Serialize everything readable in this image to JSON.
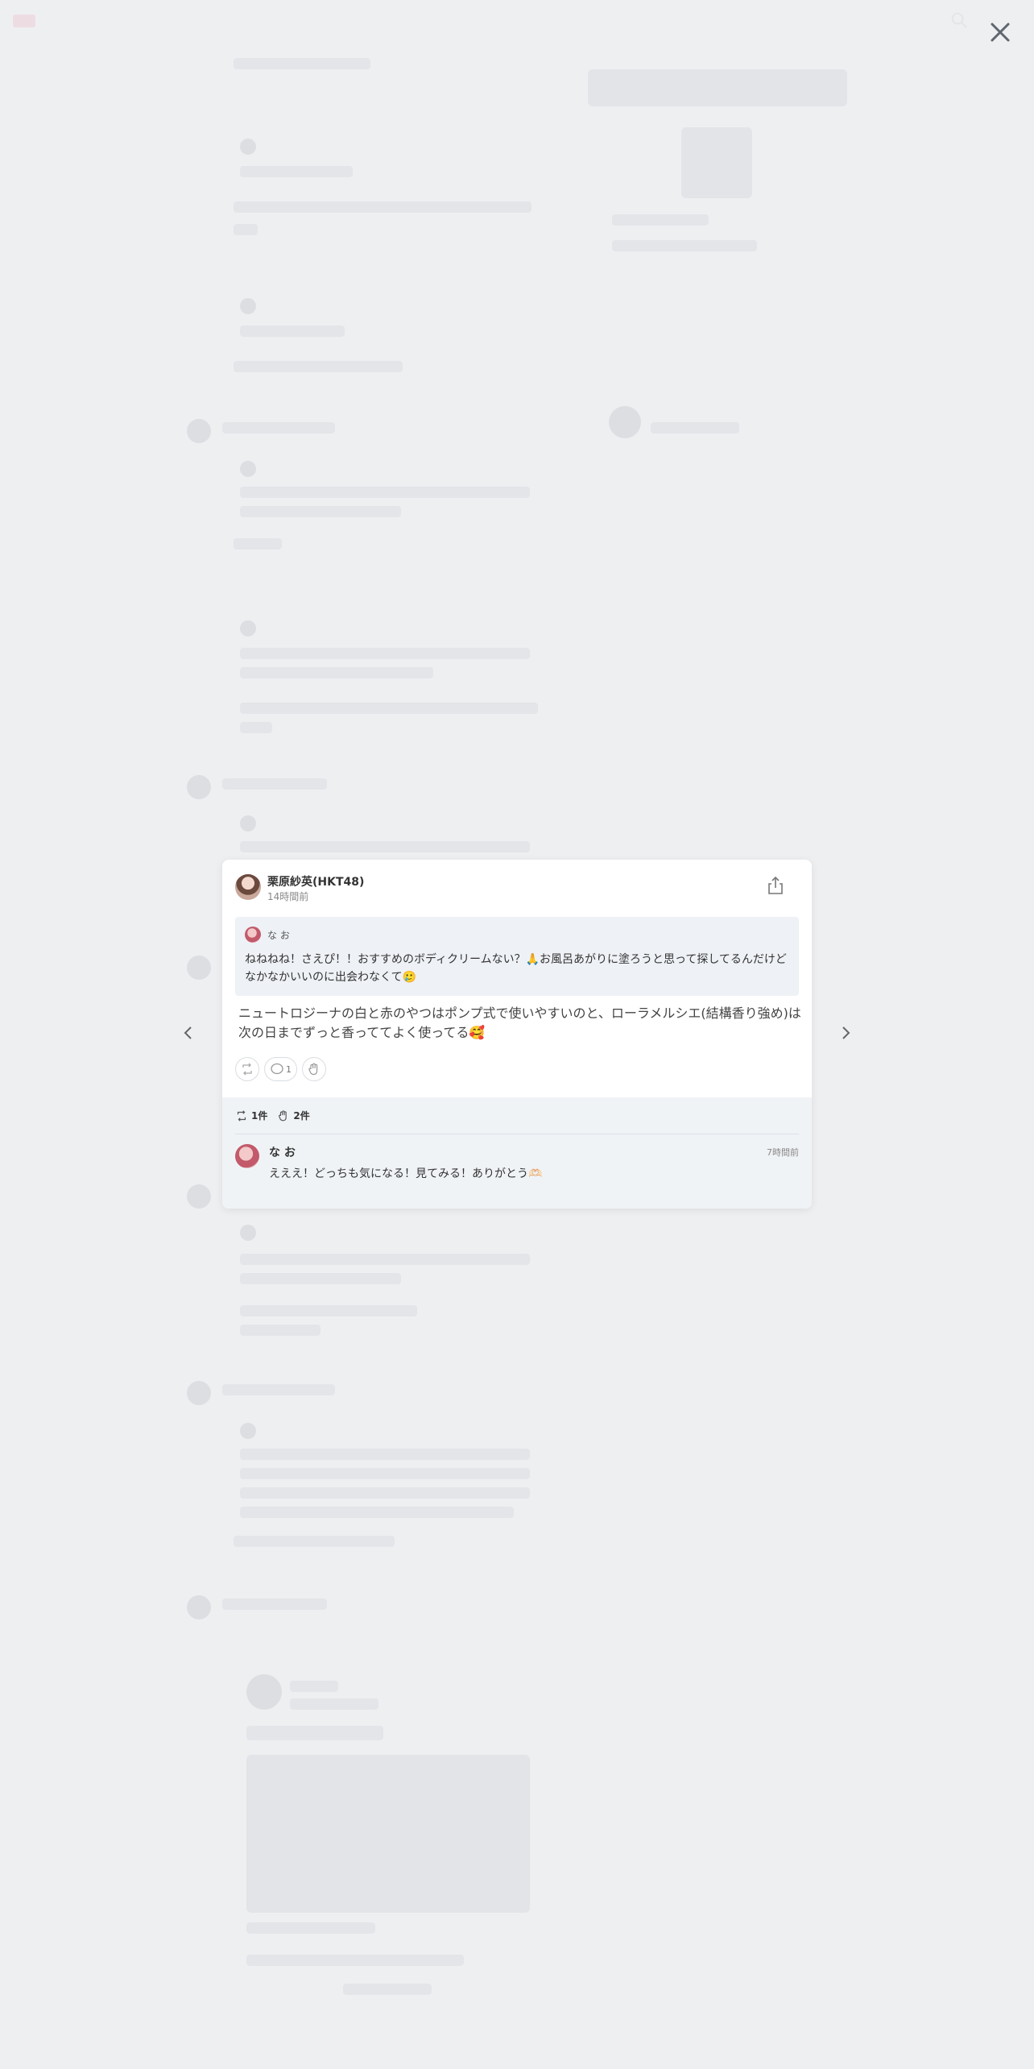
{
  "modal": {
    "author": {
      "name": "栗原紗英(HKT48)",
      "time": "14時間前"
    },
    "quoted": {
      "author": "な お",
      "text": "ねねねね！さえぴ！！おすすめのボディクリームない？🙏お風呂あがりに塗ろうと思って探してるんだけどなかなかいいのに出会わなくて🥲"
    },
    "reply_text": "ニュートロジーナの白と赤のやつはポンプ式で使いやすいのと、ローラメルシエ(結構香り強め)は次の日までずっと香っててよく使ってる🥰",
    "actions": {
      "comment_count": "1"
    },
    "stats": {
      "reposts": "1件",
      "reactions": "2件"
    },
    "comment": {
      "author": "な お",
      "time": "7時間前",
      "text": "えええ！どっちも気になる！見てみる！ありがとう🫶🏻"
    }
  },
  "icons": {
    "close": "close-icon",
    "share": "share-icon",
    "prev": "chevron-left-icon",
    "next": "chevron-right-icon",
    "repost": "repost-icon",
    "comment": "comment-icon",
    "reaction": "clap-icon"
  },
  "colors": {
    "backdrop": "#eeeff1",
    "card": "#ffffff",
    "footer": "#f0f3f6",
    "quote_bg": "#eef1f5"
  }
}
